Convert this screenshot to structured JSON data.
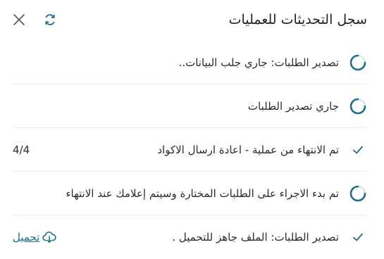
{
  "header": {
    "title": "سجل التحديثات للعمليات"
  },
  "colors": {
    "accent": "#1f6f8b",
    "spinner_track": "#d9e6ea",
    "check": "#1f6f8b"
  },
  "items": [
    {
      "status": "loading",
      "text": "تصدير الطلبات: جاري جلب البيانات..",
      "aside": ""
    },
    {
      "status": "loading",
      "text": "جاري تصدير الطلبات",
      "aside": ""
    },
    {
      "status": "done",
      "text": "تم الانتهاء من عملية - اعادة ارسال الاكواد",
      "aside": "4/4"
    },
    {
      "status": "loading",
      "text": "تم بدء الاجراء على الطلبات المختارة وسيتم إعلامك عند الانتهاء",
      "aside": ""
    },
    {
      "status": "done",
      "text": "تصدير الطلبات: الملف جاهز للتحميل .",
      "aside": "",
      "link": "تحميل",
      "link_icon": "cloud-download-icon"
    }
  ]
}
